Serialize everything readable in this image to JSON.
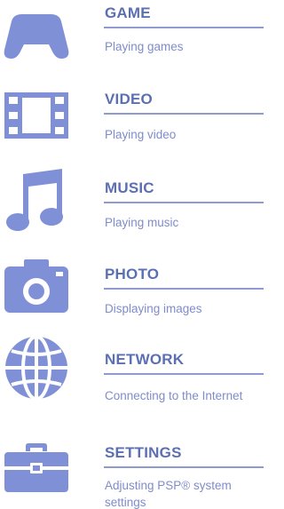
{
  "colors": {
    "icon": "#7f90d6",
    "title": "#5b6fb3",
    "rule": "#8e9ad0",
    "description": "#7f8ccb"
  },
  "menu": {
    "items": [
      {
        "key": "game",
        "icon": "game-controller-icon",
        "title": "GAME",
        "description": "Playing games"
      },
      {
        "key": "video",
        "icon": "film-strip-icon",
        "title": "VIDEO",
        "description": "Playing video"
      },
      {
        "key": "music",
        "icon": "music-note-icon",
        "title": "MUSIC",
        "description": "Playing music"
      },
      {
        "key": "photo",
        "icon": "camera-icon",
        "title": "PHOTO",
        "description": "Displaying images"
      },
      {
        "key": "network",
        "icon": "globe-icon",
        "title": "NETWORK",
        "description": "Connecting to the Internet"
      },
      {
        "key": "settings",
        "icon": "toolbox-icon",
        "title": "SETTINGS",
        "description": "Adjusting PSP® system settings"
      }
    ]
  }
}
